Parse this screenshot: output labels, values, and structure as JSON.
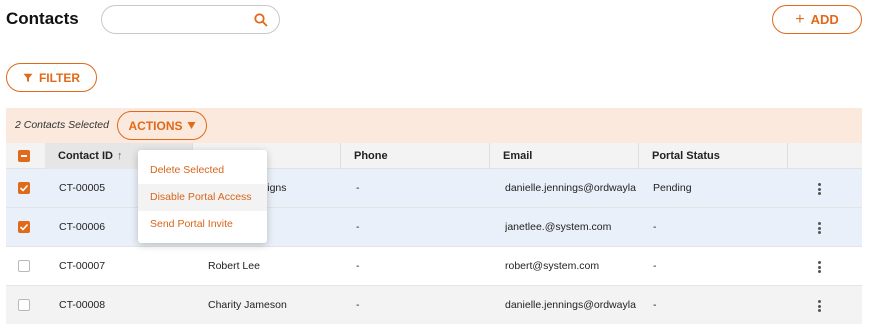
{
  "header": {
    "title": "Contacts",
    "search_placeholder": "",
    "add_label": "ADD"
  },
  "filter": {
    "label": "FILTER"
  },
  "selection": {
    "text": "2 Contacts Selected",
    "actions_label": "ACTIONS"
  },
  "actions_menu": {
    "items": [
      "Delete Selected",
      "Disable Portal Access",
      "Send Portal Invite"
    ],
    "highlighted_index": 1
  },
  "table": {
    "columns": [
      "Contact ID",
      "",
      "Phone",
      "Email",
      "Portal Status"
    ],
    "sort": {
      "column": "Contact ID",
      "direction": "ascending"
    },
    "rows": [
      {
        "id": "CT-00005",
        "name": "signs",
        "phone": "-",
        "email": "danielle.jennings@ordwayla",
        "status": "Pending",
        "checked": true
      },
      {
        "id": "CT-00006",
        "name": "",
        "phone": "-",
        "email": "janetlee.@system.com",
        "status": "-",
        "checked": true
      },
      {
        "id": "CT-00007",
        "name": "Robert Lee",
        "phone": "-",
        "email": "robert@system.com",
        "status": "-",
        "checked": false
      },
      {
        "id": "CT-00008",
        "name": "Charity Jameson",
        "phone": "-",
        "email": "danielle.jennings@ordwayla",
        "status": "-",
        "checked": false
      }
    ]
  },
  "colors": {
    "accent": "#e06a1a",
    "selection_bar": "#fbe9dd",
    "selected_row": "#eaf0f9"
  },
  "icons": [
    "search-icon",
    "plus-icon",
    "filter-icon",
    "caret-down-icon",
    "sort-arrow-icon",
    "checkbox-icon",
    "more-vertical-icon"
  ]
}
